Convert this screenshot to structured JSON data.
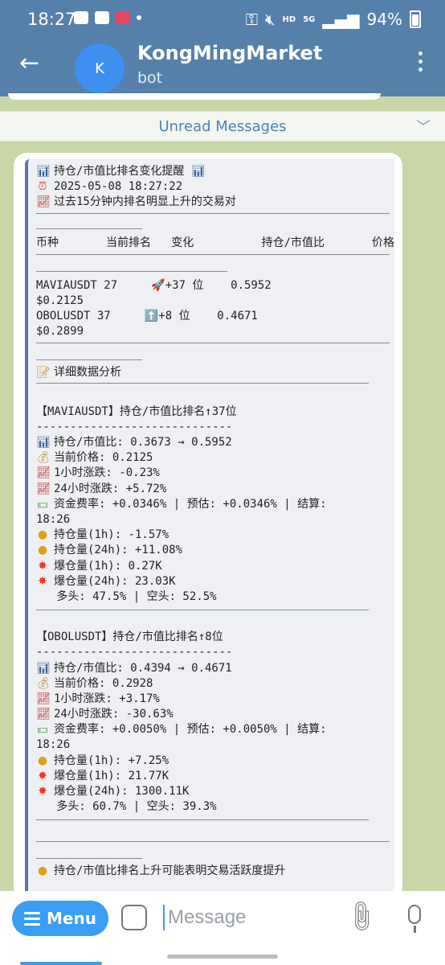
{
  "status_bar": {
    "time": "18:27",
    "network": "HD",
    "signal": "5G",
    "battery": "94%"
  },
  "header": {
    "avatar_letter": "K",
    "title": "KongMingMarket",
    "subtitle": "bot"
  },
  "unread_label": "Unread Messages",
  "message": {
    "title": "持仓/市值比排名变化提醒",
    "time": "2025-05-08 18:27:22",
    "desc": "过去15分钟内排名明显上升的交易对",
    "table_header": "币种       当前排名   变化          持仓/市值比       价格",
    "rows": [
      {
        "line1": "MAVIAUSDT 27     🚀+37 位    0.5952",
        "line2": "$0.2125"
      },
      {
        "line1": "OBOLUSDT 37     ⬆️+8 位    0.4671",
        "line2": "$0.2899"
      }
    ],
    "analysis_title": "详细数据分析",
    "dashes": "-----------------------------",
    "coins": [
      {
        "heading": "【MAVIAUSDT】持仓/市值比排名↑37位",
        "ratio": "持仓/市值比: 0.3673 → 0.5952",
        "price": "当前价格: 0.2125",
        "change_1h": "1小时涨跌: -0.23%",
        "change_24h": "24小时涨跌: +5.72%",
        "funding": "资金费率: +0.0346% | 预估: +0.0346% | 结算:",
        "settle_time": "18:26",
        "oi_1h": "持仓量(1h): -1.57%",
        "oi_24h": "持仓量(24h): +11.08%",
        "liq_1h": "爆仓量(1h): 0.27K",
        "liq_24h": "爆仓量(24h): 23.03K",
        "long_short": "   多头: 47.5% | 空头: 52.5%"
      },
      {
        "heading": "【OBOLUSDT】持仓/市值比排名↑8位",
        "ratio": "持仓/市值比: 0.4394 → 0.4671",
        "price": "当前价格: 0.2928",
        "change_1h": "1小时涨跌: +3.17%",
        "change_24h": "24小时涨跌: -30.63%",
        "funding": "资金费率: +0.0050% | 预估: +0.0050% | 结算:",
        "settle_time": "18:26",
        "oi_1h": "持仓量(1h): +7.25%",
        "liq_1h": "爆仓量(1h): 21.77K",
        "liq_24h": "爆仓量(24h): 1300.11K",
        "long_short": "   多头: 60.7% | 空头: 39.3%"
      }
    ],
    "cut_off_line": "持仓/市值比排名上升可能表明交易活跃度提升"
  },
  "bottom_bar": {
    "menu_label": "Menu",
    "message_placeholder": "Message"
  }
}
